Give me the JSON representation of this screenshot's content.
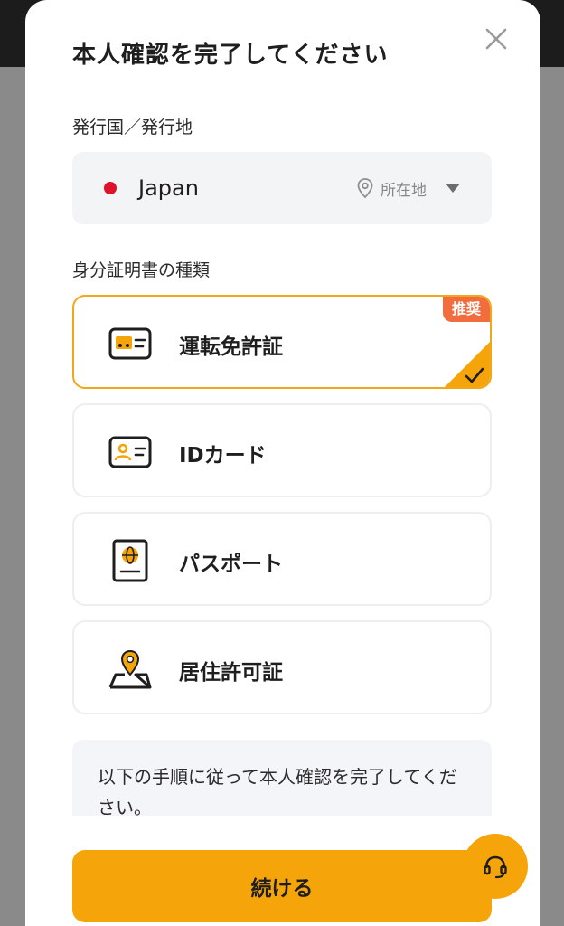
{
  "modal": {
    "title": "本人確認を完了してください"
  },
  "issuing": {
    "label": "発行国／発行地",
    "country": "Japan",
    "location_label": "所在地"
  },
  "documents": {
    "label": "身分証明書の種類",
    "items": [
      {
        "label": "運転免許証",
        "selected": true,
        "badge": "推奨"
      },
      {
        "label": "IDカード",
        "selected": false
      },
      {
        "label": "パスポート",
        "selected": false
      },
      {
        "label": "居住許可証",
        "selected": false
      }
    ]
  },
  "steps": {
    "text": "以下の手順に従って本人確認を完了してください。"
  },
  "actions": {
    "continue_label": "続ける"
  },
  "colors": {
    "accent": "#f5a50a",
    "badge": "#f26d3d",
    "flag_red": "#e0112a"
  }
}
